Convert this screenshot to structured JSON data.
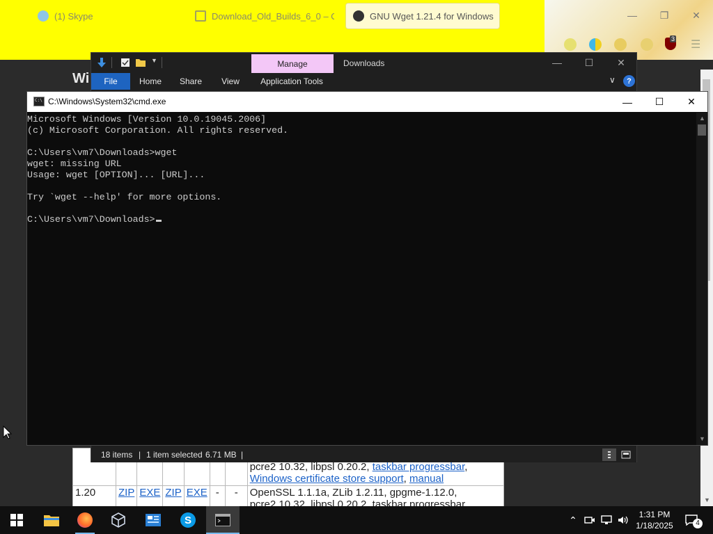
{
  "browser": {
    "tabs": [
      {
        "label": "(1) Skype"
      },
      {
        "label": "Download_Old_Builds_6_0 – Oc"
      },
      {
        "label": "GNU Wget 1.21.4 for Windows"
      }
    ],
    "ublock_badge": "3",
    "page_heading": "Wi",
    "colors": {
      "tabbar": "#ffff00",
      "active_tab": "#fffbd0",
      "link": "#1c62c8"
    }
  },
  "wget_table": {
    "rows": [
      {
        "version": "1.20",
        "cells": [
          "ZIP",
          "EXE",
          "ZIP",
          "EXE",
          "-",
          "-"
        ],
        "notes_line1": "OpenSSL 1.1.1a, ZLib 1.2.11, gpgme-1.12.0,",
        "notes_line2": "pcre2 10.32, libpsl 0.20.2, taskbar progressbar"
      }
    ],
    "partial_prefix": "pcre2 10.32, libpsl 0.20.2,",
    "partial_link1": "taskbar progressbar",
    "partial_link2": "Windows certificate store support",
    "partial_sep": ",",
    "partial_link3": "manual"
  },
  "explorer": {
    "title": "Downloads",
    "contextual_tab": "Manage",
    "ribbon_tabs": [
      "File",
      "Home",
      "Share",
      "View",
      "Application Tools"
    ],
    "status": {
      "items": "18 items",
      "sep": "|",
      "selected": "1 item selected",
      "size": "6.71 MB"
    },
    "colors": {
      "manage_tab": "#f3c7f7",
      "file_tab": "#1e64c0"
    }
  },
  "cmd": {
    "title": "C:\\Windows\\System32\\cmd.exe",
    "lines": [
      "Microsoft Windows [Version 10.0.19045.2006]",
      "(c) Microsoft Corporation. All rights reserved.",
      "",
      "C:\\Users\\vm7\\Downloads>wget",
      "wget: missing URL",
      "Usage: wget [OPTION]... [URL]...",
      "",
      "Try `wget --help' for more options.",
      ""
    ],
    "prompt": "C:\\Users\\vm7\\Downloads>"
  },
  "taskbar": {
    "clock_time": "1:31 PM",
    "clock_date": "1/18/2025",
    "notification_count": "4",
    "accent": "#76b9ed"
  }
}
